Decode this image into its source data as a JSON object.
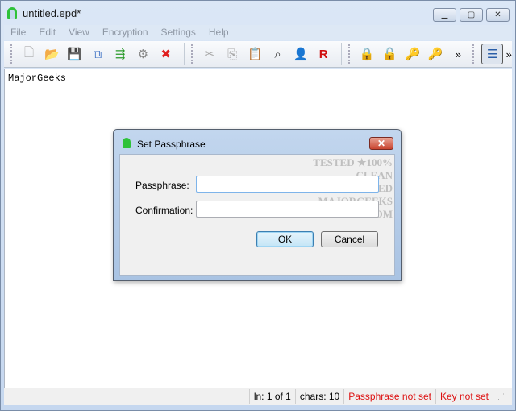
{
  "window": {
    "title": "untitled.epd*",
    "controls": [
      "minimize",
      "maximize",
      "close"
    ]
  },
  "menu": [
    "File",
    "Edit",
    "View",
    "Encryption",
    "Settings",
    "Help"
  ],
  "toolbar": {
    "groups": [
      [
        {
          "name": "new-icon",
          "glyph": "🗋",
          "color": "#999"
        },
        {
          "name": "open-icon",
          "glyph": "📂",
          "color": "#e0a020"
        },
        {
          "name": "save-icon",
          "glyph": "💾",
          "color": "#3b6fc4"
        },
        {
          "name": "save-all-icon",
          "glyph": "⧉",
          "color": "#3b6fc4"
        },
        {
          "name": "save-as-icon",
          "glyph": "⇶",
          "color": "#2a9a2a"
        },
        {
          "name": "properties-icon",
          "glyph": "⚙",
          "color": "#888"
        },
        {
          "name": "close-file-icon",
          "glyph": "✖",
          "color": "#e02020"
        }
      ],
      [
        {
          "name": "cut-icon",
          "glyph": "✂",
          "color": "#aaa"
        },
        {
          "name": "copy-icon",
          "glyph": "⎘",
          "color": "#aaa"
        },
        {
          "name": "paste-icon",
          "glyph": "📋",
          "color": "#c08030"
        },
        {
          "name": "find-icon",
          "glyph": "⌕",
          "color": "#333"
        },
        {
          "name": "user-icon",
          "glyph": "👤",
          "color": "#4070b0"
        },
        {
          "name": "replace-icon",
          "glyph": "R",
          "color": "#d01010"
        }
      ],
      [
        {
          "name": "lock-icon",
          "glyph": "🔒",
          "color": "#d4a020"
        },
        {
          "name": "unlock-icon",
          "glyph": "🔓",
          "color": "#aaa"
        },
        {
          "name": "add-key-icon",
          "glyph": "🔑",
          "color": "#d4a020"
        },
        {
          "name": "key-icon",
          "glyph": "🔑",
          "color": "#e0b020"
        }
      ]
    ],
    "overflow": "»",
    "word_wrap_icon": "word-wrap-icon"
  },
  "editor": {
    "text": "MajorGeeks"
  },
  "status": {
    "line": "ln: 1 of 1",
    "chars": "chars: 10",
    "passphrase": "Passphrase not set",
    "key": "Key not set",
    "error_color": "#d11111"
  },
  "dialog": {
    "title": "Set Passphrase",
    "passphrase_label": "Passphrase:",
    "passphrase_value": "",
    "confirmation_label": "Confirmation:",
    "confirmation_value": "",
    "ok": "OK",
    "cancel": "Cancel",
    "watermark": "TESTED ★100% CLEAN CERTIFIED MAJORGEEKS .COM"
  }
}
